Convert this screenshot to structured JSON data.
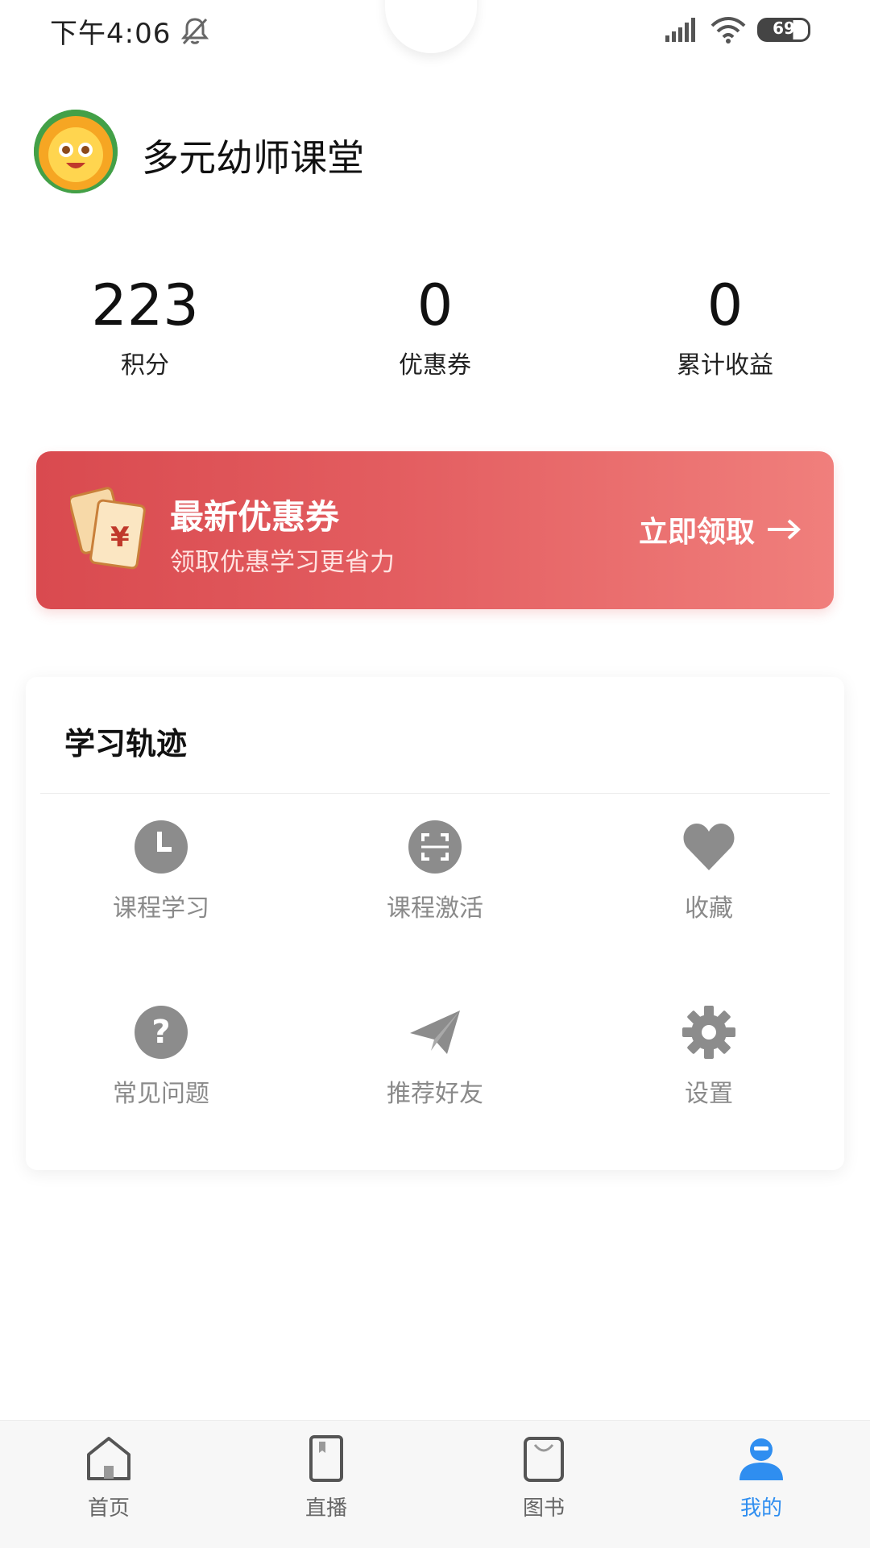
{
  "status_bar": {
    "time": "下午4:06",
    "battery": "69"
  },
  "profile": {
    "name": "多元幼师课堂",
    "avatar_icon": "sunflower-avatar"
  },
  "stats": [
    {
      "value": "223",
      "label": "积分"
    },
    {
      "value": "0",
      "label": "优惠券"
    },
    {
      "value": "0",
      "label": "累计收益"
    }
  ],
  "coupon": {
    "title": "最新优惠券",
    "subtitle": "领取优惠学习更省力",
    "action_label": "立即领取",
    "icon": "coupon-ticket-icon",
    "color_start": "#d94a4f",
    "color_end": "#f07f7c"
  },
  "learning_track": {
    "title": "学习轨迹",
    "items": [
      {
        "label": "课程学习",
        "icon": "clock-icon"
      },
      {
        "label": "课程激活",
        "icon": "scan-icon"
      },
      {
        "label": "收藏",
        "icon": "heart-icon"
      },
      {
        "label": "常见问题",
        "icon": "question-icon"
      },
      {
        "label": "推荐好友",
        "icon": "paper-plane-icon"
      },
      {
        "label": "设置",
        "icon": "gear-icon"
      }
    ]
  },
  "tab_bar": {
    "active_color": "#2f8ef0",
    "tabs": [
      {
        "label": "首页",
        "icon": "home-icon",
        "active": false
      },
      {
        "label": "直播",
        "icon": "live-book-icon",
        "active": false
      },
      {
        "label": "图书",
        "icon": "bag-icon",
        "active": false
      },
      {
        "label": "我的",
        "icon": "user-icon",
        "active": true
      }
    ]
  }
}
